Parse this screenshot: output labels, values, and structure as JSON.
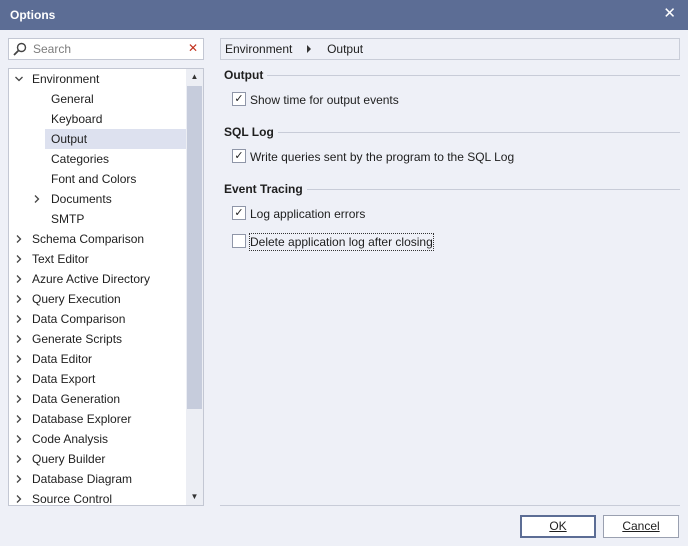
{
  "window": {
    "title": "Options",
    "close_glyph": "✕"
  },
  "search": {
    "placeholder": "Search",
    "value": "",
    "icon": "search-icon",
    "clear_glyph": "✕"
  },
  "tree": {
    "items": [
      {
        "label": "Environment",
        "state": "expanded",
        "selected": false
      },
      {
        "label": "General",
        "state": "none",
        "selected": false
      },
      {
        "label": "Keyboard",
        "state": "none",
        "selected": false
      },
      {
        "label": "Output",
        "state": "none",
        "selected": true
      },
      {
        "label": "Categories",
        "state": "none",
        "selected": false
      },
      {
        "label": "Font and Colors",
        "state": "none",
        "selected": false
      },
      {
        "label": "Documents",
        "state": "collapsed",
        "selected": false
      },
      {
        "label": "SMTP",
        "state": "none",
        "selected": false
      },
      {
        "label": "Schema Comparison",
        "state": "collapsed",
        "selected": false
      },
      {
        "label": "Text Editor",
        "state": "collapsed",
        "selected": false
      },
      {
        "label": "Azure Active Directory",
        "state": "collapsed",
        "selected": false
      },
      {
        "label": "Query Execution",
        "state": "collapsed",
        "selected": false
      },
      {
        "label": "Data Comparison",
        "state": "collapsed",
        "selected": false
      },
      {
        "label": "Generate Scripts",
        "state": "collapsed",
        "selected": false
      },
      {
        "label": "Data Editor",
        "state": "collapsed",
        "selected": false
      },
      {
        "label": "Data Export",
        "state": "collapsed",
        "selected": false
      },
      {
        "label": "Data Generation",
        "state": "collapsed",
        "selected": false
      },
      {
        "label": "Database Explorer",
        "state": "collapsed",
        "selected": false
      },
      {
        "label": "Code Analysis",
        "state": "collapsed",
        "selected": false
      },
      {
        "label": "Query Builder",
        "state": "collapsed",
        "selected": false
      },
      {
        "label": "Database Diagram",
        "state": "collapsed",
        "selected": false
      },
      {
        "label": "Source Control",
        "state": "collapsed",
        "selected": false
      }
    ]
  },
  "breadcrumb": {
    "root": "Environment",
    "current": "Output"
  },
  "sections": {
    "output": {
      "title": "Output",
      "options": [
        {
          "label": "Show time for output events",
          "checked": true
        }
      ]
    },
    "sql_log": {
      "title": "SQL Log",
      "options": [
        {
          "label": "Write queries sent by the program to the SQL Log",
          "checked": true
        }
      ]
    },
    "event_tracing": {
      "title": "Event Tracing",
      "options": [
        {
          "label": "Log application errors",
          "checked": true
        },
        {
          "label": "Delete application log after closing",
          "checked": false
        }
      ]
    }
  },
  "buttons": {
    "ok_label": "OK",
    "cancel_label": "Cancel"
  },
  "colors": {
    "titlebar": "#5c6d95",
    "background": "#eef0f7",
    "selection": "#dde1ef",
    "clear_icon": "#c2311d"
  }
}
